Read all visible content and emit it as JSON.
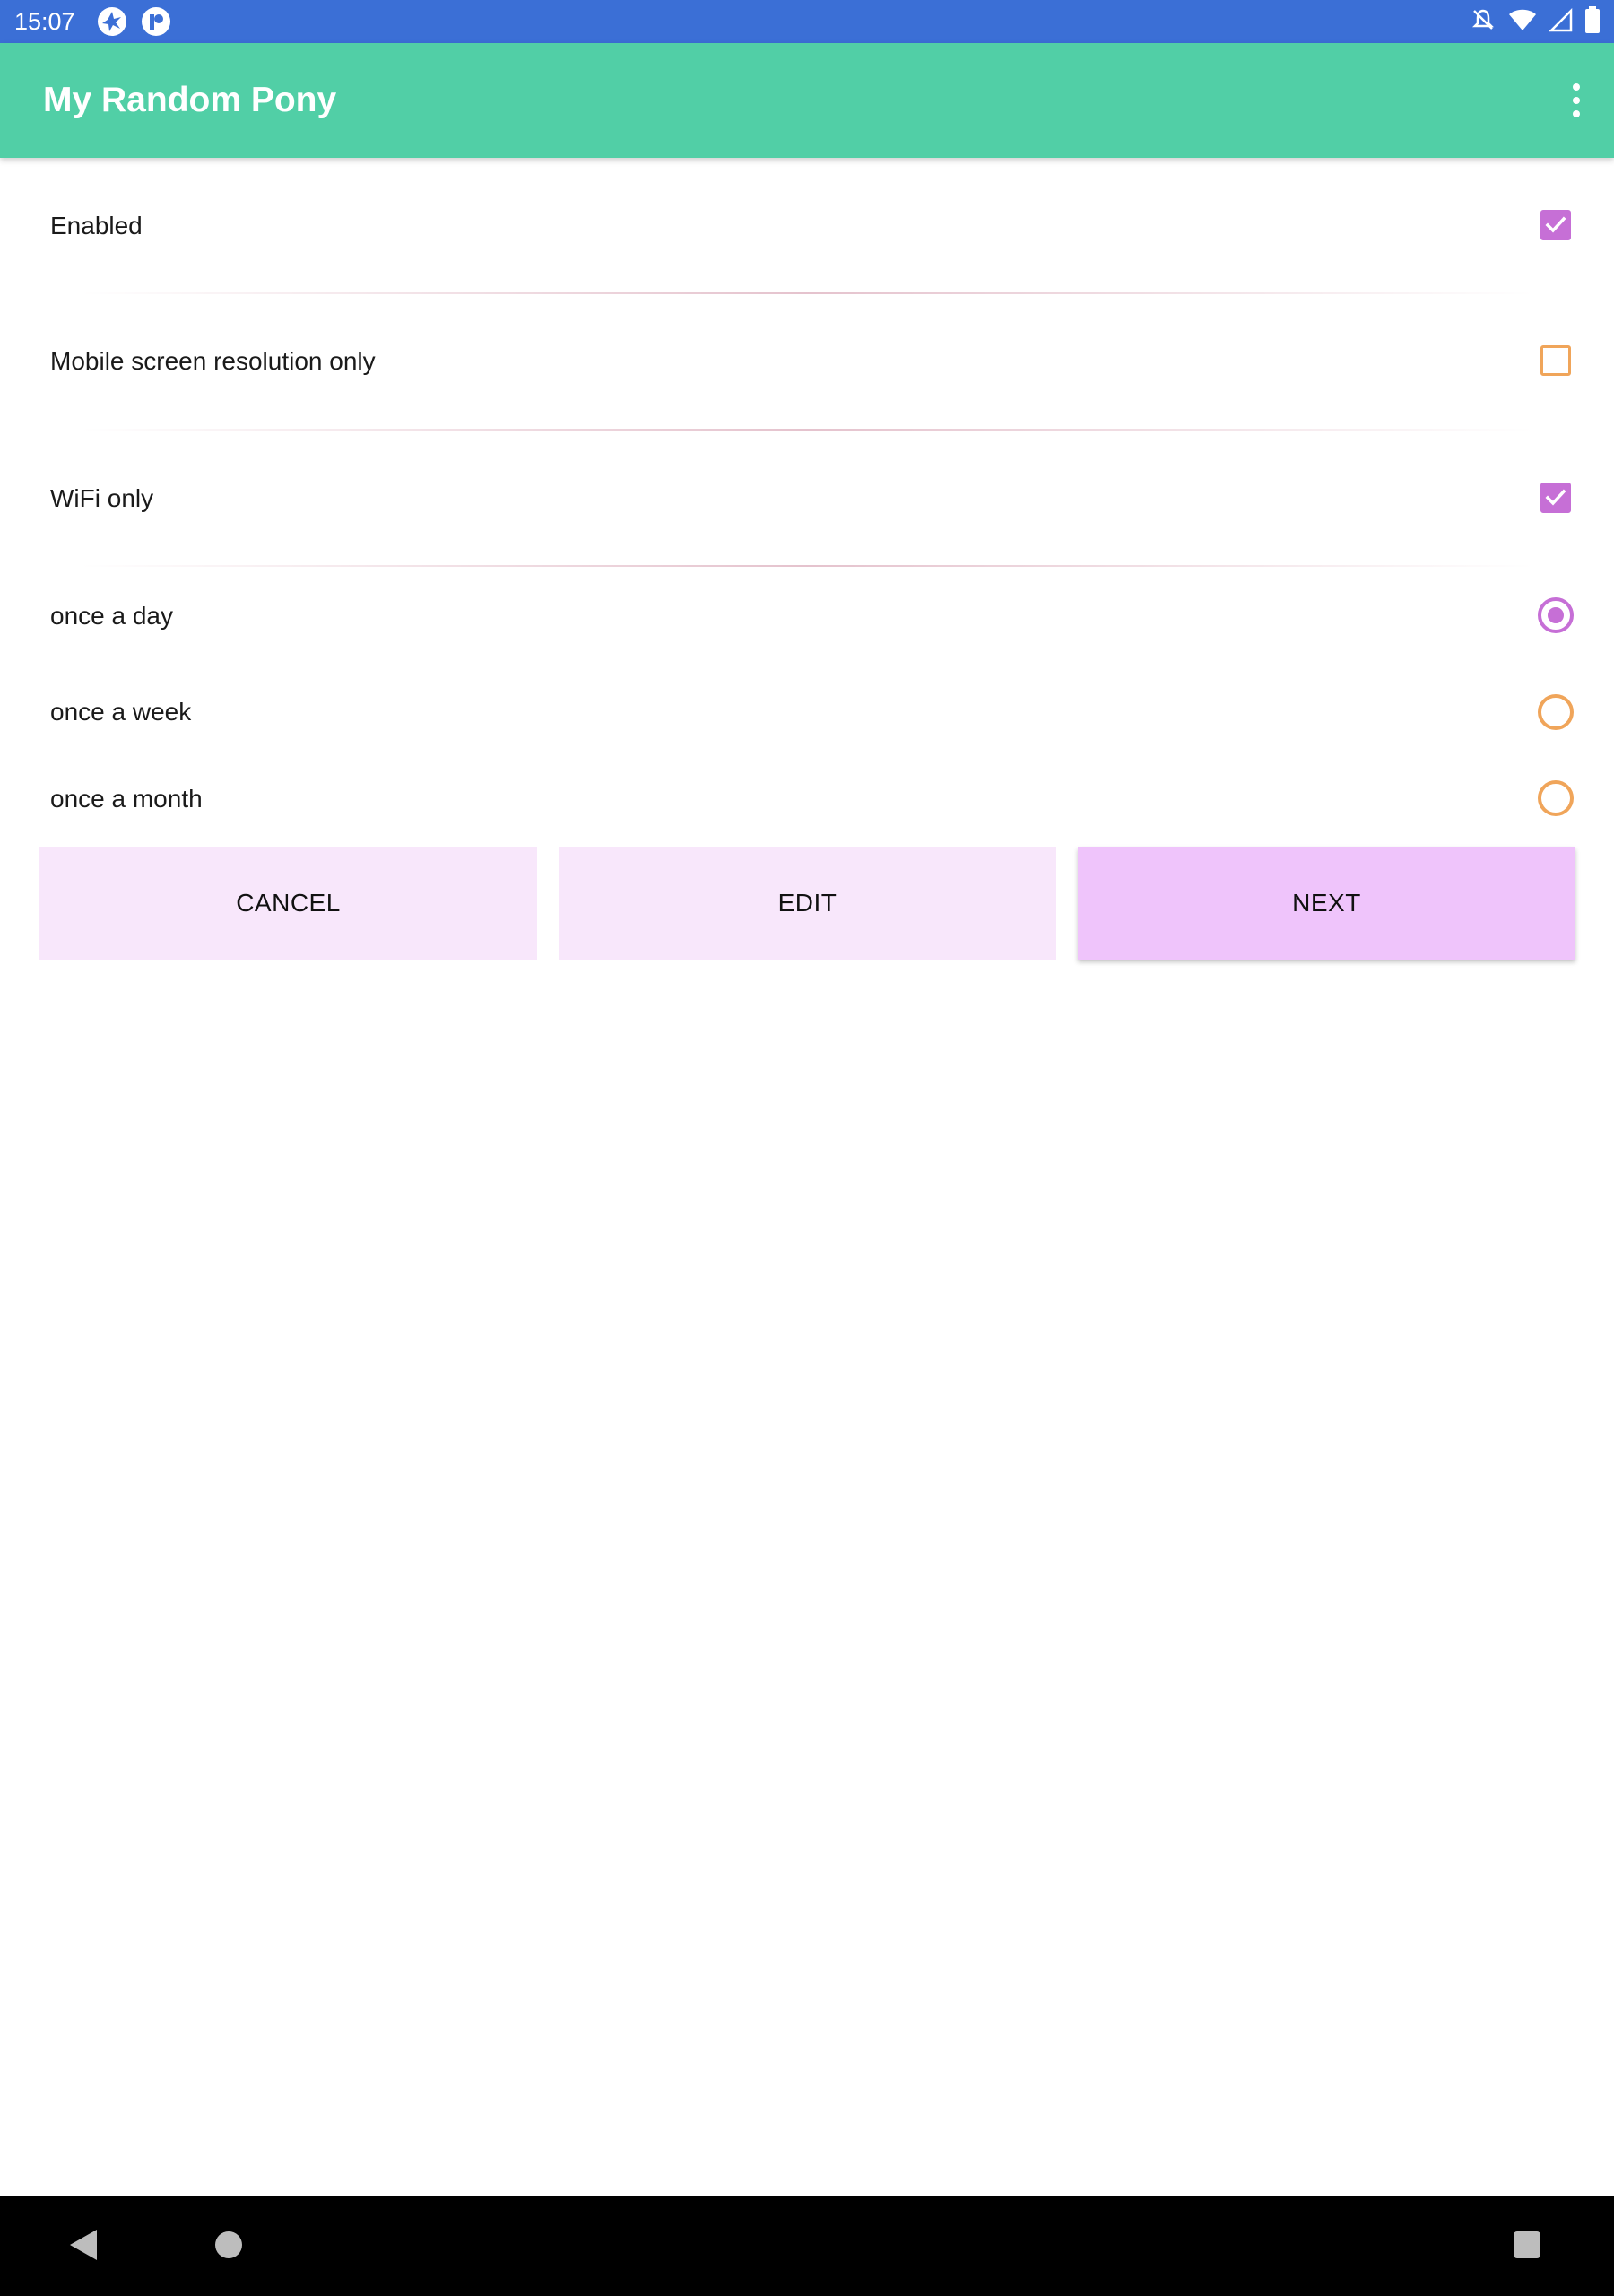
{
  "status_bar": {
    "time": "15:07",
    "left_icons": [
      "app-notification-icon",
      "app-notification-icon-2"
    ],
    "right_icons": [
      "notifications-off-icon",
      "wifi-icon",
      "cellular-signal-icon",
      "battery-icon"
    ],
    "background": "#3b6fd6"
  },
  "app_bar": {
    "title": "My Random Pony",
    "background": "#51cfa6",
    "overflow_icon": "more-vert-icon"
  },
  "settings": {
    "enabled": {
      "label": "Enabled",
      "checked": true
    },
    "mobile_resolution": {
      "label": "Mobile screen resolution only",
      "checked": false
    },
    "wifi_only": {
      "label": "WiFi only",
      "checked": true
    }
  },
  "frequency": {
    "options": [
      {
        "label": "once a day",
        "selected": true
      },
      {
        "label": "once a week",
        "selected": false
      },
      {
        "label": "once a month",
        "selected": false
      }
    ]
  },
  "buttons": {
    "cancel": "CANCEL",
    "edit": "EDIT",
    "next": "NEXT"
  },
  "colors": {
    "accent_checked": "#c66fd6",
    "accent_unchecked": "#f0a55a",
    "button_light": "#f8e7fb",
    "button_primary": "#efc4fb"
  },
  "nav_bar": {
    "icons": [
      "back-icon",
      "home-icon",
      "recents-icon"
    ]
  }
}
